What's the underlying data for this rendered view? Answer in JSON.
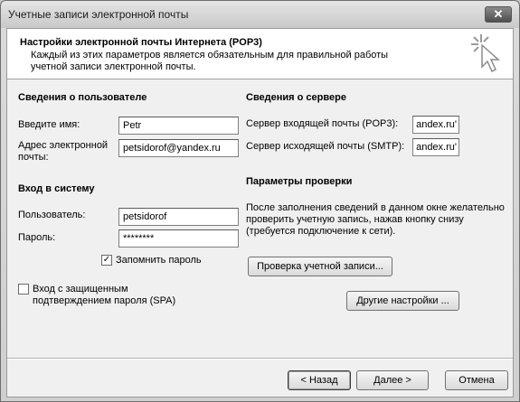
{
  "window": {
    "title": "Учетные записи электронной почты",
    "close_label": "✕"
  },
  "header": {
    "title": "Настройки электронной почты Интернета (POP3)",
    "description": "Каждый из этих параметров является обязательным для правильной работы учетной записи электронной почты.",
    "icon": "cursor-sparkle-icon"
  },
  "user_info": {
    "section_title": "Сведения о пользователе",
    "name_label": "Введите имя:",
    "name_value": "Petr",
    "email_label": "Адрес электронной почты:",
    "email_value": "petsidorof@yandex.ru"
  },
  "login": {
    "section_title": "Вход в систему",
    "user_label": "Пользователь:",
    "user_value": "petsidorof",
    "password_label": "Пароль:",
    "password_value": "********",
    "remember_label": "Запомнить пароль",
    "remember_checked": true,
    "spa_label": "Вход с защищенным подтверждением пароля (SPA)",
    "spa_checked": false
  },
  "server_info": {
    "section_title": "Сведения о сервере",
    "incoming_label": "Сервер входящей почты (POP3):",
    "incoming_value": "'andex.ru",
    "outgoing_label": "Сервер исходящей почты (SMTP):",
    "outgoing_value": "'andex.ru"
  },
  "test_settings": {
    "section_title": "Параметры проверки",
    "description": "После заполнения сведений в данном окне желательно проверить учетную запись, нажав кнопку снизу (требуется подключение к сети).",
    "test_button": "Проверка учетной записи...",
    "more_button": "Другие настройки ..."
  },
  "footer": {
    "back_button": "< Назад",
    "next_button": "Далее >",
    "cancel_button": "Отмена"
  }
}
